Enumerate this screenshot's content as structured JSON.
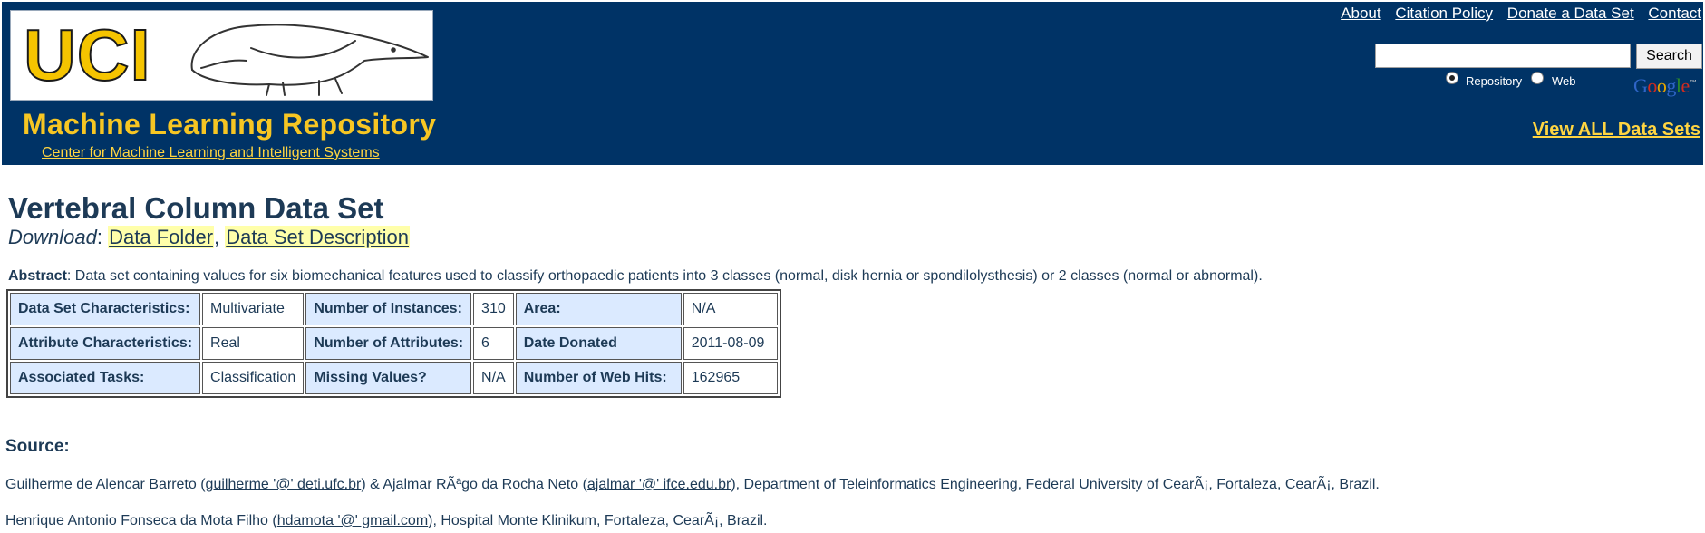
{
  "header": {
    "logo_text": "UCI",
    "repo_title": "Machine Learning Repository",
    "repo_subtitle": "Center for Machine Learning and Intelligent Systems",
    "top_links": [
      "About",
      "Citation Policy",
      "Donate a Data Set",
      "Contact"
    ],
    "search": {
      "value": "",
      "placeholder": "",
      "button_label": "Search"
    },
    "radio_options": [
      {
        "label": "Repository",
        "selected": true
      },
      {
        "label": "Web",
        "selected": false
      }
    ],
    "google_logo": "Google",
    "view_all_label": "View ALL Data Sets",
    "colors": {
      "background": "#003366",
      "accent": "#f7c623"
    }
  },
  "dataset": {
    "title": "Vertebral Column Data Set",
    "download_label": "Download",
    "download_links": [
      "Data Folder",
      "Data Set Description"
    ],
    "abstract_label": "Abstract",
    "abstract_text": ": Data set containing values for six biomechanical features used to classify orthopaedic patients into 3 classes (normal, disk hernia or spondilolysthesis) or 2 classes (normal or abnormal).",
    "info_table": [
      [
        {
          "key": "Data Set Characteristics:",
          "value": "Multivariate"
        },
        {
          "key": "Number of Instances:",
          "value": "310"
        },
        {
          "key": "Area:",
          "value": "N/A"
        }
      ],
      [
        {
          "key": "Attribute Characteristics:",
          "value": "Real"
        },
        {
          "key": "Number of Attributes:",
          "value": "6"
        },
        {
          "key": "Date Donated",
          "value": "2011-08-09"
        }
      ],
      [
        {
          "key": "Associated Tasks:",
          "value": "Classification"
        },
        {
          "key": "Missing Values?",
          "value": "N/A"
        },
        {
          "key": "Number of Web Hits:",
          "value": "162965"
        }
      ]
    ]
  },
  "source": {
    "heading": "Source:",
    "line1": {
      "pre": "Guilherme de Alencar Barreto (",
      "email1": "guilherme '@' deti.ufc.br",
      "mid": ") & Ajalmar RÃªgo da Rocha Neto (",
      "email2": "ajalmar '@' ifce.edu.br",
      "post": "), Department of Teleinformatics Engineering, Federal University of CearÃ¡, Fortaleza, CearÃ¡, Brazil."
    },
    "line2": {
      "pre": "Henrique Antonio Fonseca da Mota Filho (",
      "email": "hdamota '@' gmail.com",
      "post": "), Hospital Monte Klinikum, Fortaleza, CearÃ¡, Brazil."
    }
  }
}
